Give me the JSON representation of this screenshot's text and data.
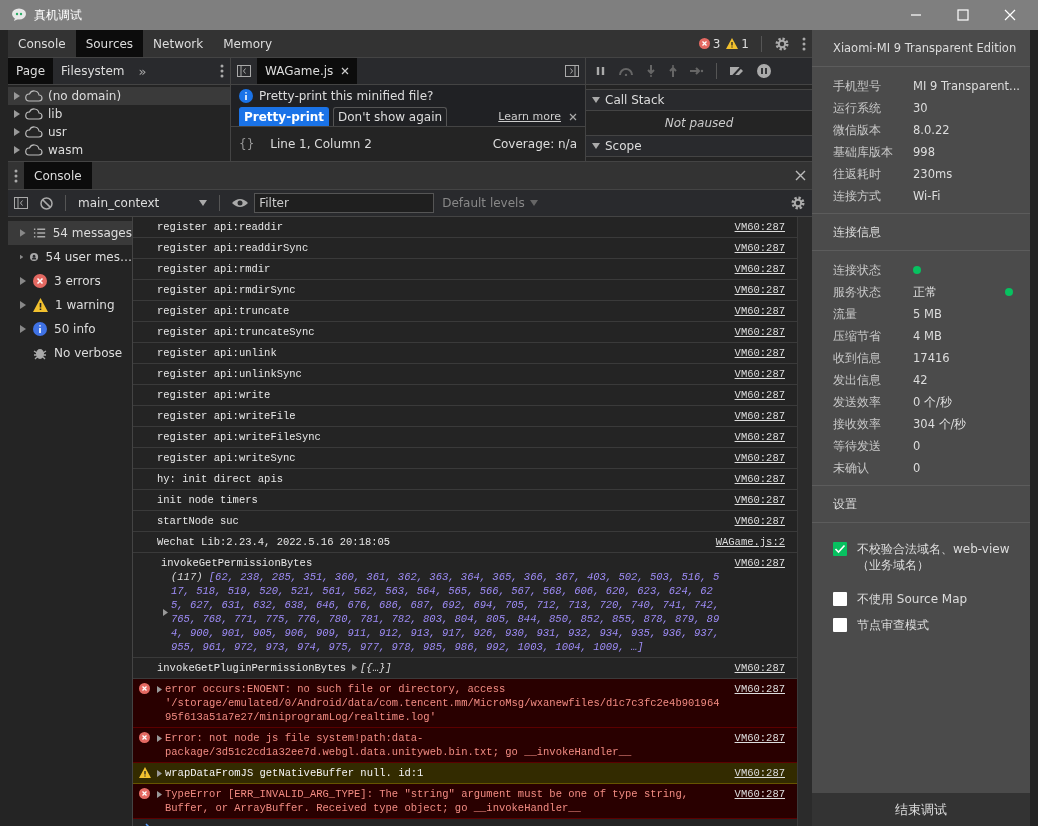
{
  "window": {
    "title": "真机调试"
  },
  "devtools": {
    "tabs": [
      {
        "label": "Console",
        "selected": false
      },
      {
        "label": "Sources",
        "selected": true
      },
      {
        "label": "Network",
        "selected": false
      },
      {
        "label": "Memory",
        "selected": false
      }
    ],
    "error_count": "3",
    "warning_count": "1",
    "sources": {
      "navigator_tabs": [
        {
          "label": "Page",
          "selected": true
        },
        {
          "label": "Filesystem",
          "selected": false
        }
      ],
      "more": "»",
      "tree": [
        {
          "label": "(no domain)",
          "selected": true
        },
        {
          "label": "lib",
          "selected": false
        },
        {
          "label": "usr",
          "selected": false
        },
        {
          "label": "wasm",
          "selected": false
        }
      ],
      "editor_tab": "WAGame.js",
      "infobar": {
        "message": "Pretty-print this minified file?",
        "link": "Learn more",
        "buttons": [
          {
            "label": "Pretty-print",
            "primary": true
          },
          {
            "label": "Don't show again",
            "primary": false
          }
        ]
      },
      "footer": {
        "format": "{}",
        "position": "Line 1, Column 2",
        "coverage": "Coverage: n/a"
      },
      "debugger_sections": [
        {
          "title": "Call Stack",
          "expanded": true,
          "body": "Not paused"
        },
        {
          "title": "Scope",
          "expanded": true
        }
      ]
    },
    "drawer": {
      "tab": "Console",
      "context": "main_context",
      "filter_placeholder": "Filter",
      "levels": "Default levels",
      "sidebar": [
        {
          "label": "54 messages",
          "kind": "all",
          "selected": true
        },
        {
          "label": "54 user mes…",
          "kind": "user",
          "selected": false
        },
        {
          "label": "3 errors",
          "kind": "error",
          "selected": false
        },
        {
          "label": "1 warning",
          "kind": "warning",
          "selected": false
        },
        {
          "label": "50 info",
          "kind": "info",
          "selected": false
        },
        {
          "label": "No verbose",
          "kind": "verbose",
          "selected": false
        }
      ],
      "messages": [
        {
          "kind": "log",
          "text": "register api:readdir",
          "source": "VM60:287"
        },
        {
          "kind": "log",
          "text": "register api:readdirSync",
          "source": "VM60:287"
        },
        {
          "kind": "log",
          "text": "register api:rmdir",
          "source": "VM60:287"
        },
        {
          "kind": "log",
          "text": "register api:rmdirSync",
          "source": "VM60:287"
        },
        {
          "kind": "log",
          "text": "register api:truncate",
          "source": "VM60:287"
        },
        {
          "kind": "log",
          "text": "register api:truncateSync",
          "source": "VM60:287"
        },
        {
          "kind": "log",
          "text": "register api:unlink",
          "source": "VM60:287"
        },
        {
          "kind": "log",
          "text": "register api:unlinkSync",
          "source": "VM60:287"
        },
        {
          "kind": "log",
          "text": "register api:write",
          "source": "VM60:287"
        },
        {
          "kind": "log",
          "text": "register api:writeFile",
          "source": "VM60:287"
        },
        {
          "kind": "log",
          "text": "register api:writeFileSync",
          "source": "VM60:287"
        },
        {
          "kind": "log",
          "text": "register api:writeSync",
          "source": "VM60:287"
        },
        {
          "kind": "log",
          "text": "hy: init direct apis",
          "source": "VM60:287"
        },
        {
          "kind": "log",
          "text": "init node timers",
          "source": "VM60:287"
        },
        {
          "kind": "log",
          "text": "startNode suc",
          "source": "VM60:287"
        },
        {
          "kind": "log",
          "text": "Wechat Lib:2.23.4, 2022.5.16 20:18:05",
          "source": "WAGame.js:2"
        },
        {
          "kind": "array",
          "text": "invokeGetPermissionBytes",
          "count": "(117)",
          "values": "[62, 238, 285, 351, 360, 361, 362, 363, 364, 365, 366, 367, 403, 502, 503, 516, 517, 518, 519, 520, 521, 561, 562, 563, 564, 565, 566, 567, 568, 606, 620, 623, 624, 625, 627, 631, 632, 638, 646, 676, 686, 687, 692, 694, 705, 712, 713, 720, 740, 741, 742, 765, 768, 771, 775, 776, 780, 781, 782, 803, 804, 805, 844, 850, 852, 855, 878, 879, 894, 900, 901, 905, 906, 909, 911, 912, 913, 917, 926, 930, 931, 932, 934, 935, 936, 937, 955, 961, 972, 973, 974, 975, 977, 978, 985, 986, 992, 1003, 1004, 1009, …]",
          "source": "VM60:287"
        },
        {
          "kind": "object",
          "text": "invokeGetPluginPermissionBytes",
          "values": "[{…}]",
          "source": "VM60:287"
        },
        {
          "kind": "error",
          "text": "error occurs:ENOENT: no such file or directory, access '/storage/emulated/0/Android/data/com.tencent.mm/MicroMsg/wxanewfiles/d1c7c3fc2e4b90196495f613a51a7e27/miniprogramLog/realtime.log'",
          "source": "VM60:287"
        },
        {
          "kind": "error",
          "text": "Error: not node js file system!path:data-package/3d51c2cd1a32ee7d.webgl.data.unityweb.bin.txt; go __invokeHandler__",
          "source": "VM60:287"
        },
        {
          "kind": "warning",
          "text": "wrapDataFromJS getNativeBuffer null. id:1",
          "source": "VM60:287"
        },
        {
          "kind": "error",
          "text": "TypeError [ERR_INVALID_ARG_TYPE]: The \"string\" argument must be one of type string, Buffer, or ArrayBuffer. Received type object; go __invokeHandler__",
          "source": "VM60:287"
        }
      ]
    }
  },
  "device_panel": {
    "title": "Xiaomi-MI 9 Transparent Edition",
    "info": [
      {
        "label": "手机型号",
        "value": "MI 9 Transparent..."
      },
      {
        "label": "运行系统",
        "value": "30"
      },
      {
        "label": "微信版本",
        "value": "8.0.22"
      },
      {
        "label": "基础库版本",
        "value": "998"
      },
      {
        "label": "往返耗时",
        "value": "230ms"
      },
      {
        "label": "连接方式",
        "value": "Wi-Fi"
      }
    ],
    "connection_heading": "连接信息",
    "connection": [
      {
        "label": "连接状态",
        "online": true
      },
      {
        "label": "服务状态",
        "value": "正常",
        "online": true
      },
      {
        "label": "流量",
        "value": "5 MB"
      },
      {
        "label": "压缩节省",
        "value": "4 MB"
      },
      {
        "label": "收到信息",
        "value": "17416"
      },
      {
        "label": "发出信息",
        "value": "42"
      },
      {
        "label": "发送效率",
        "value": "0 个/秒"
      },
      {
        "label": "接收效率",
        "value": "304 个/秒"
      },
      {
        "label": "等待发送",
        "value": "0"
      },
      {
        "label": "未确认",
        "value": "0"
      }
    ],
    "settings_heading": "设置",
    "settings": [
      {
        "label": "不校验合法域名、web-view（业务域名）",
        "checked": true
      },
      {
        "label": "不使用 Source Map",
        "checked": false
      },
      {
        "label": "节点审查模式",
        "checked": false
      }
    ],
    "end_button": "结束调试"
  }
}
